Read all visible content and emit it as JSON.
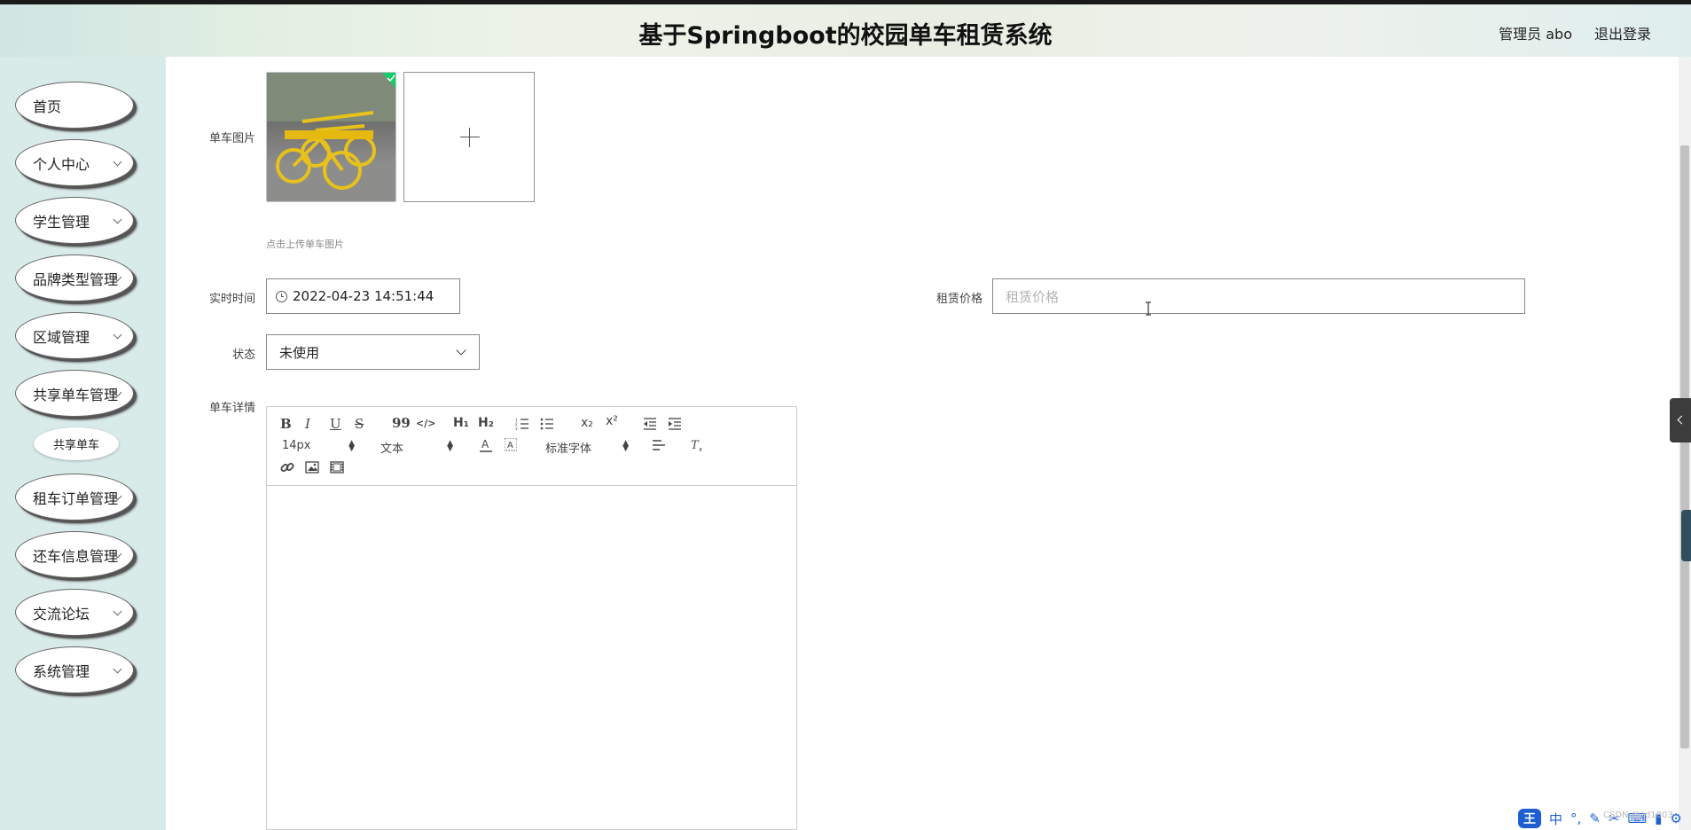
{
  "header": {
    "title": "基于Springboot的校园单车租赁系统",
    "user": "管理员 abo",
    "logout": "退出登录"
  },
  "sidebar": {
    "items": [
      {
        "label": "首页",
        "expandable": false
      },
      {
        "label": "个人中心",
        "expandable": true
      },
      {
        "label": "学生管理",
        "expandable": true
      },
      {
        "label": "品牌类型管理",
        "expandable": true
      },
      {
        "label": "区域管理",
        "expandable": true
      },
      {
        "label": "共享单车管理",
        "expandable": true
      },
      {
        "label": "租车订单管理",
        "expandable": true
      },
      {
        "label": "还车信息管理",
        "expandable": true
      },
      {
        "label": "交流论坛",
        "expandable": true
      },
      {
        "label": "系统管理",
        "expandable": true
      }
    ],
    "submenu": {
      "label": "共享单车"
    }
  },
  "form": {
    "image_label": "单车图片",
    "upload_tip": "点击上传单车图片",
    "time_label": "实时时间",
    "time_value": "2022-04-23 14:51:44",
    "price_label": "租赁价格",
    "price_placeholder": "租赁价格",
    "status_label": "状态",
    "status_value": "未使用",
    "detail_label": "单车详情"
  },
  "editor": {
    "toolbar": {
      "bold": "B",
      "italic": "I",
      "underline": "U",
      "strike": "S",
      "blockquote": "99",
      "code": "</>",
      "h1": "H₁",
      "h2": "H₂",
      "subscript": "x₂",
      "superscript": "x²",
      "size": "14px",
      "header": "文本",
      "font": "标准字体"
    }
  },
  "ime": {
    "logo": "王",
    "mode": "中",
    "punct": "°,"
  },
  "watermark": "CSDN @zd1803"
}
